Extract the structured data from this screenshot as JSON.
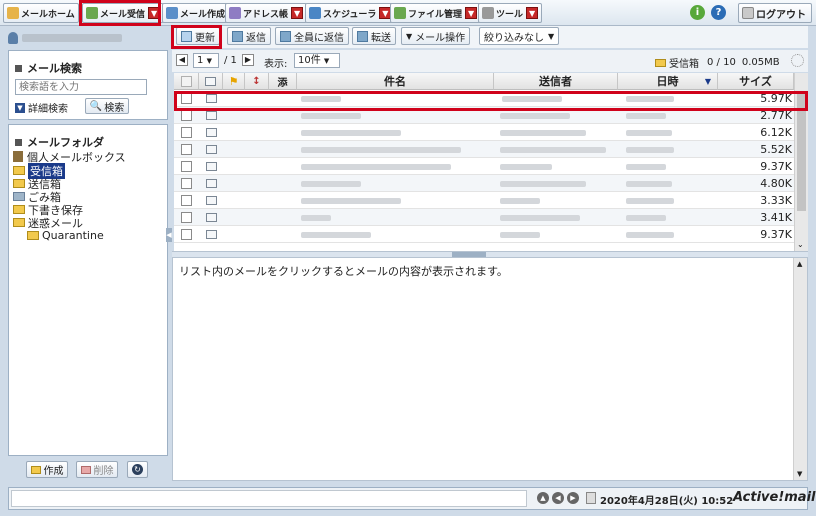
{
  "topbar": {
    "buttons": [
      {
        "label": "メールホーム",
        "icon": "home-icon",
        "dropdown": false
      },
      {
        "label": "メール受信",
        "icon": "mail-receive-icon",
        "dropdown": true
      },
      {
        "label": "メール作成",
        "icon": "compose-icon",
        "dropdown": false
      },
      {
        "label": "アドレス帳",
        "icon": "address-book-icon",
        "dropdown": true
      },
      {
        "label": "スケジューラ",
        "icon": "calendar-icon",
        "dropdown": true
      },
      {
        "label": "ファイル管理",
        "icon": "file-icon",
        "dropdown": true
      },
      {
        "label": "ツール",
        "icon": "gear-icon",
        "dropdown": true
      }
    ],
    "info_glyph": "i",
    "help_glyph": "?",
    "logout_label": "ログアウト"
  },
  "left": {
    "search_title": "メール検索",
    "search_placeholder": "検索語を入力",
    "detail_search_label": "詳細検索",
    "search_button_label": "検索",
    "folder_title": "メールフォルダ",
    "mailbox_label": "個人メールボックス",
    "folders": [
      "受信箱",
      "送信箱",
      "ごみ箱",
      "下書き保存",
      "迷惑メール",
      "Quarantine"
    ],
    "create_label": "作成",
    "delete_label": "削除"
  },
  "toolbar": {
    "refresh_label": "更新",
    "reply_label": "返信",
    "reply_all_label": "全員に返信",
    "forward_label": "転送",
    "mail_ops_label": "メール操作",
    "filter_label": "絞り込みなし"
  },
  "pager": {
    "page": "1",
    "total": "/ 1",
    "display_label": "表示:",
    "per_page": "10件",
    "folder_name": "受信箱",
    "count": "0 / 10",
    "usage": "0.05MB"
  },
  "table": {
    "headers": {
      "attach": "添",
      "subject": "件名",
      "sender": "送信者",
      "date": "日時",
      "size": "サイズ"
    },
    "sizes": [
      "5.97K",
      "2.77K",
      "6.12K",
      "5.52K",
      "9.37K",
      "4.80K",
      "3.33K",
      "3.41K",
      "9.37K"
    ]
  },
  "preview": {
    "message": "リスト内のメールをクリックするとメールの内容が表示されます。"
  },
  "status": {
    "datetime": "2020年4月28日(火) 10:52",
    "brand": "Active!mail"
  },
  "colors": {
    "highlight": "#d0021b",
    "selected_folder": "#1a3a8a"
  }
}
